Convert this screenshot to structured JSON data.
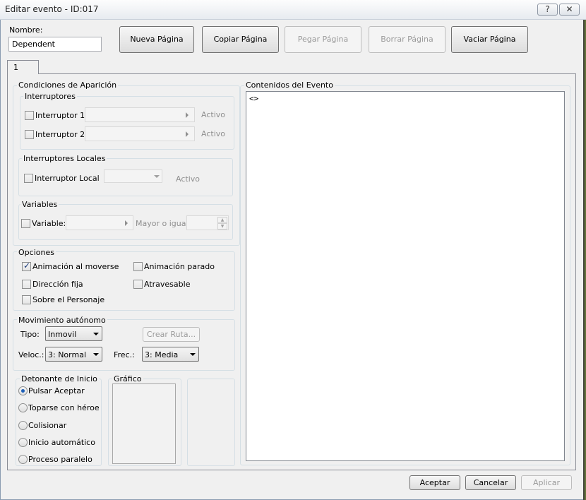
{
  "window": {
    "title": "Editar evento - ID:017",
    "help_btn": "?",
    "close_btn": "✕"
  },
  "name": {
    "label": "Nombre:",
    "value": "Dependent"
  },
  "page_buttons": {
    "new": "Nueva Página",
    "copy": "Copiar Página",
    "paste": "Pegar Página",
    "delete": "Borrar Página",
    "clear": "Vaciar Página"
  },
  "tabs": [
    "1"
  ],
  "conditions": {
    "title": "Condiciones de Aparición",
    "switches": {
      "title": "Interruptores",
      "switch1": {
        "label": "Interruptor 1",
        "status": "Activo"
      },
      "switch2": {
        "label": "Interruptor 2",
        "status": "Activo"
      }
    },
    "local_switches": {
      "title": "Interruptores Locales",
      "label": "Interruptor Local",
      "status": "Activo"
    },
    "variables": {
      "title": "Variables",
      "label": "Variable:",
      "compare": "Mayor o igual"
    }
  },
  "options": {
    "title": "Opciones",
    "walk_anim": {
      "label": "Animación al moverse",
      "checked": true
    },
    "step_anim": {
      "label": "Animación parado",
      "checked": false
    },
    "fixed_dir": {
      "label": "Dirección fija",
      "checked": false
    },
    "through": {
      "label": "Atravesable",
      "checked": false
    },
    "above": {
      "label": "Sobre el Personaje",
      "checked": false
    }
  },
  "movement": {
    "title": "Movimiento autónomo",
    "type_label": "Tipo:",
    "type_value": "Inmovil",
    "route_button": "Crear Ruta...",
    "speed_label": "Veloc.:",
    "speed_value": "3: Normal",
    "freq_label": "Frec.:",
    "freq_value": "3: Media"
  },
  "trigger": {
    "title": "Detonante de Inicio",
    "options": [
      {
        "label": "Pulsar Aceptar",
        "selected": true
      },
      {
        "label": "Toparse con héroe",
        "selected": false
      },
      {
        "label": "Colisionar",
        "selected": false
      },
      {
        "label": "Inicio automático",
        "selected": false
      },
      {
        "label": "Proceso paralelo",
        "selected": false
      }
    ]
  },
  "graphic": {
    "title": "Gráfico"
  },
  "contents": {
    "title": "Contenidos del Evento",
    "first_line": "<>"
  },
  "footer": {
    "ok": "Aceptar",
    "cancel": "Cancelar",
    "apply": "Aplicar"
  }
}
